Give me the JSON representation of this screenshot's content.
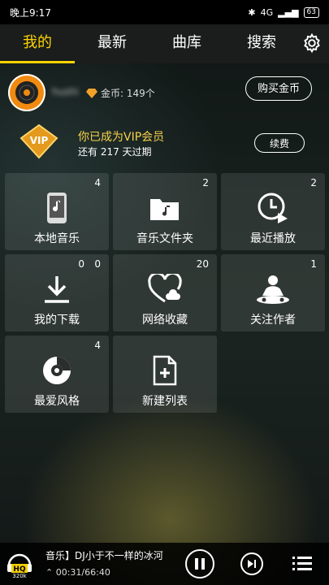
{
  "status": {
    "time": "晚上9:17",
    "network": "4G",
    "battery": "63"
  },
  "tabs": [
    {
      "label": "我的",
      "active": true
    },
    {
      "label": "最新",
      "active": false
    },
    {
      "label": "曲库",
      "active": false
    },
    {
      "label": "搜索",
      "active": false
    }
  ],
  "profile": {
    "username": "hushi",
    "coins_label": "金币: 149个",
    "buy_label": "购买金币"
  },
  "vip": {
    "badge": "VIP",
    "title": "你已成为VIP会员",
    "subtitle": "还有 217 天过期",
    "renew_label": "续费"
  },
  "tiles": [
    {
      "label": "本地音乐",
      "count": "4",
      "icon": "phone-music-icon"
    },
    {
      "label": "音乐文件夹",
      "count": "2",
      "icon": "folder-music-icon"
    },
    {
      "label": "最近播放",
      "count": "2",
      "icon": "clock-play-icon"
    },
    {
      "label": "我的下载",
      "count": "0",
      "count2": "0",
      "icon": "download-icon"
    },
    {
      "label": "网络收藏",
      "count": "20",
      "icon": "cloud-heart-icon"
    },
    {
      "label": "关注作者",
      "count": "1",
      "icon": "dj-icon"
    },
    {
      "label": "最爱风格",
      "count": "4",
      "icon": "disc-icon"
    },
    {
      "label": "新建列表",
      "count": "",
      "icon": "new-file-icon"
    }
  ],
  "player": {
    "quality_top": "HQ",
    "quality_bottom": "320k",
    "song": "音乐】DJ小于不一样的冰河",
    "time": "00:31/66:40"
  },
  "colors": {
    "accent": "#ffd400",
    "vip_gold": "#f7d24a"
  }
}
